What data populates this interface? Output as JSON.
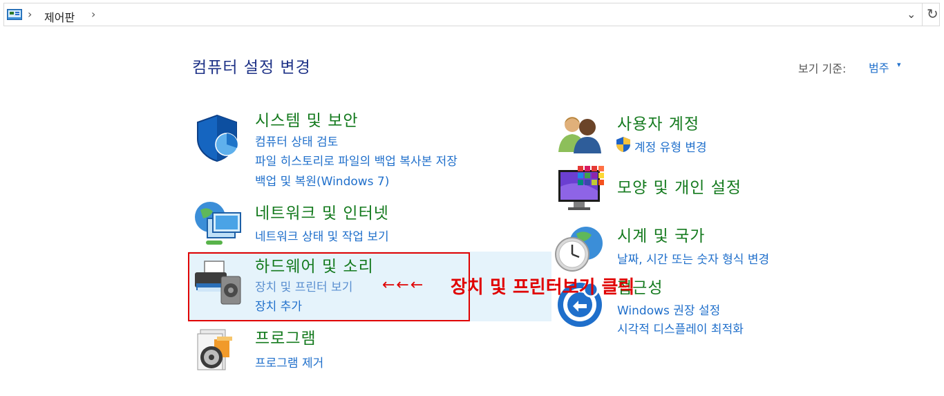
{
  "address_bar": {
    "breadcrumb": "제어판",
    "separator": "›",
    "dropdown_glyph": "⌄",
    "refresh_glyph": "↻"
  },
  "header": {
    "title": "컴퓨터 설정 변경",
    "view_by_label": "보기 기준:",
    "view_by_value": "범주",
    "view_by_arrow": "▾"
  },
  "categories": [
    {
      "title": "시스템 및 보안",
      "links": [
        "컴퓨터 상태 검토",
        "파일 히스토리로 파일의 백업 복사본 저장",
        "백업 및 복원(Windows 7)"
      ]
    },
    {
      "title": "네트워크 및 인터넷",
      "links": [
        "네트워크 상태 및 작업 보기"
      ]
    },
    {
      "title": "하드웨어 및 소리",
      "links": [
        "장치 및 프린터 보기",
        "장치 추가"
      ]
    },
    {
      "title": "프로그램",
      "links": [
        "프로그램 제거"
      ]
    },
    {
      "title": "사용자 계정",
      "links": [
        "계정 유형 변경"
      ]
    },
    {
      "title": "모양 및 개인 설정",
      "links": []
    },
    {
      "title": "시계 및 국가",
      "links": [
        "날짜, 시간 또는 숫자 형식 변경"
      ]
    },
    {
      "title": "접근성",
      "links": [
        "Windows 권장 설정",
        "시각적 디스플레이 최적화"
      ]
    }
  ],
  "annotation": {
    "arrows": "←←←",
    "text": "장치 및 프린터보기 클릭"
  },
  "colors": {
    "title_blue": "#1e3287",
    "category_green": "#147a1e",
    "link_blue": "#1f6fcb",
    "annotation_red": "#e00000",
    "highlight": "#e5f3fb"
  }
}
